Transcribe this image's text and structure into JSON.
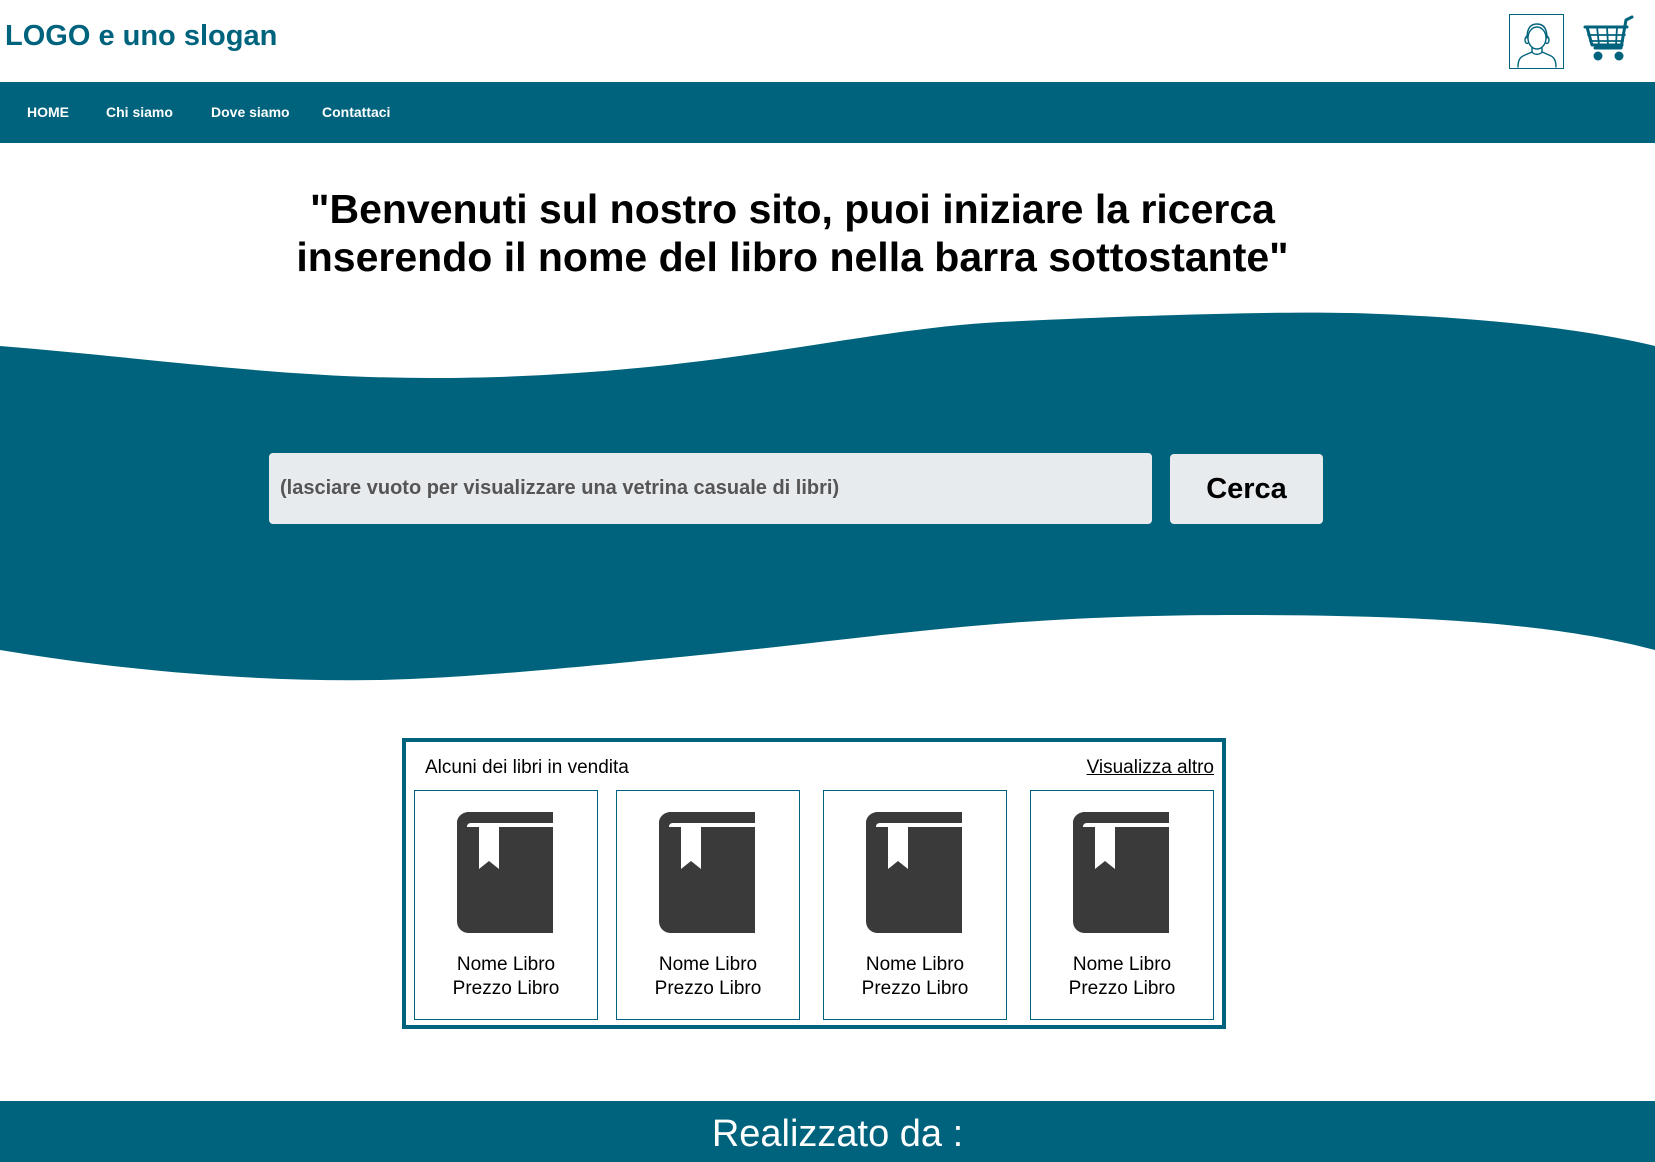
{
  "header": {
    "logo": "LOGO e uno slogan",
    "user_icon": "user-avatar-icon",
    "cart_icon": "shopping-cart-icon"
  },
  "nav": {
    "items": [
      {
        "label": "HOME"
      },
      {
        "label": "Chi siamo"
      },
      {
        "label": "Dove siamo"
      },
      {
        "label": "Contattaci"
      }
    ]
  },
  "hero": {
    "line1": "\"Benvenuti sul nostro sito, puoi iniziare la ricerca",
    "line2": "inserendo il nome del libro nella barra sottostante\""
  },
  "search": {
    "placeholder": "(lasciare vuoto per visualizzare una vetrina casuale di libri)",
    "value": "",
    "button_label": "Cerca"
  },
  "books": {
    "title": "Alcuni dei libri in vendita",
    "more_label": "Visualizza altro",
    "items": [
      {
        "name": "Nome Libro",
        "price": "Prezzo Libro",
        "icon": "book-icon"
      },
      {
        "name": "Nome Libro",
        "price": "Prezzo Libro",
        "icon": "book-icon"
      },
      {
        "name": "Nome Libro",
        "price": "Prezzo Libro",
        "icon": "book-icon"
      },
      {
        "name": "Nome Libro",
        "price": "Prezzo Libro",
        "icon": "book-icon"
      }
    ]
  },
  "footer": {
    "text": "Realizzato da :"
  },
  "colors": {
    "brand": "#00637d",
    "input_bg": "#e8ebee",
    "book_icon": "#3a3a3a"
  }
}
